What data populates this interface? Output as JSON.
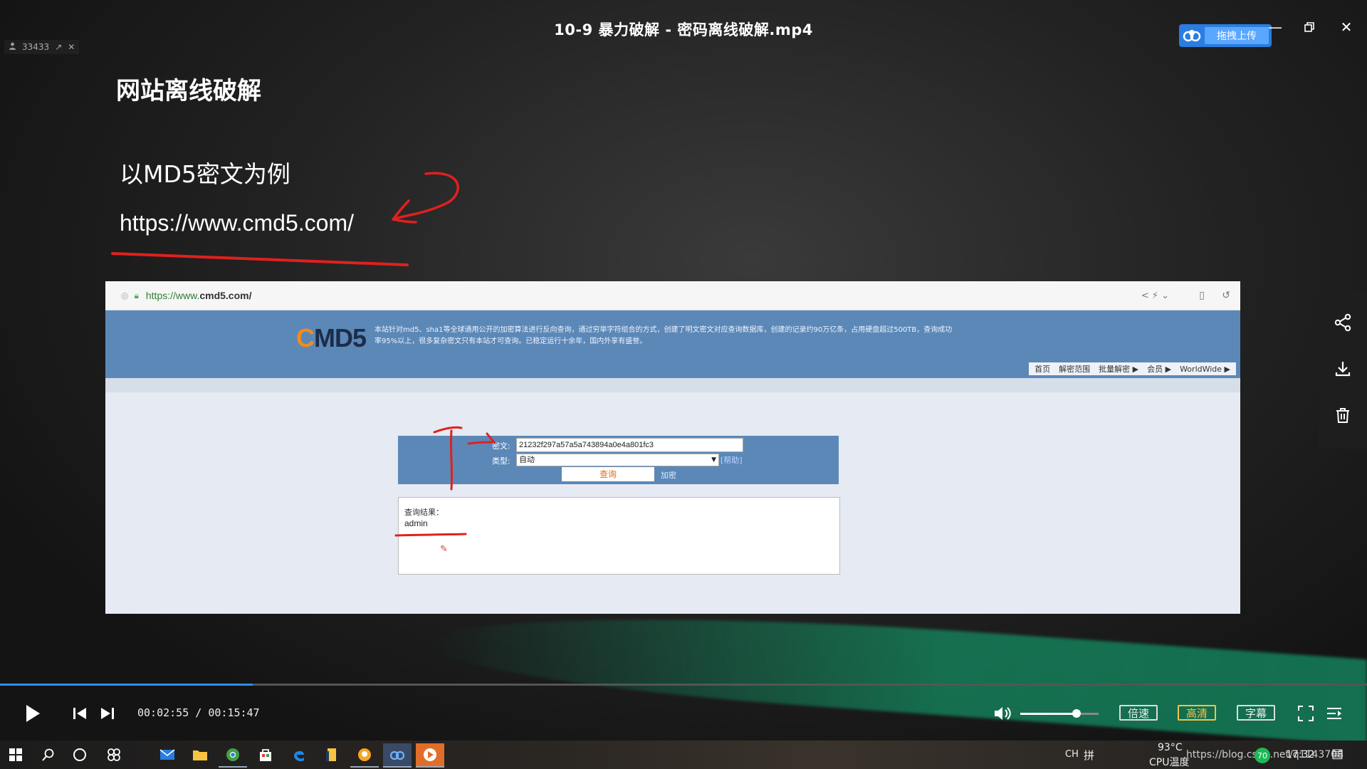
{
  "window": {
    "title": "10-9 暴力破解 - 密码离线破解.mp4",
    "view_count": "33433",
    "upload_label": "拖拽上传"
  },
  "slide": {
    "heading": "网站离线破解",
    "subtitle": "以MD5密文为例",
    "url": "https://www.cmd5.com/"
  },
  "site": {
    "address_prefix": "https://www.",
    "address_domain": "cmd5.com/",
    "logo_c": "C",
    "logo_rest": "MD5",
    "description": "本站针对md5、sha1等全球通用公开的加密算法进行反向查询，通过穷举字符组合的方式，创建了明文密文对应查询数据库，创建的记录约90万亿条，占用硬盘超过500TB，查询成功率95%以上，很多复杂密文只有本站才可查询。已稳定运行十余年，国内外享有盛誉。",
    "nav": [
      "首页",
      "解密范围",
      "批量解密 ▶",
      "会员 ▶",
      "WorldWide ▶"
    ],
    "cipher_label": "密文:",
    "cipher_value": "21232f297a57a5a743894a0e4a801fc3",
    "type_label": "类型:",
    "type_value": "自动",
    "help_link": "[帮助]",
    "query_button": "查询",
    "encrypt_link": "加密",
    "result_label": "查询结果：",
    "result_value": "admin"
  },
  "player": {
    "current_time": "00:02:55",
    "total_time": "00:15:47",
    "time_display": "00:02:55 / 00:15:47",
    "progress": 0.185,
    "volume": 0.72,
    "speed_label": "倍速",
    "quality_label": "高清",
    "subtitle_label": "字幕"
  },
  "taskbar": {
    "ime": "CH",
    "temperature": "93°C",
    "temp_label": "CPU温度",
    "tray_url": "https://blog.csdn.net/q1143708",
    "clock": "17:32",
    "badge": "70"
  },
  "colors": {
    "accent": "#2d8cf0",
    "site_header": "#5b88b7",
    "hd": "#f3c24a",
    "annotation": "#e0201e"
  }
}
